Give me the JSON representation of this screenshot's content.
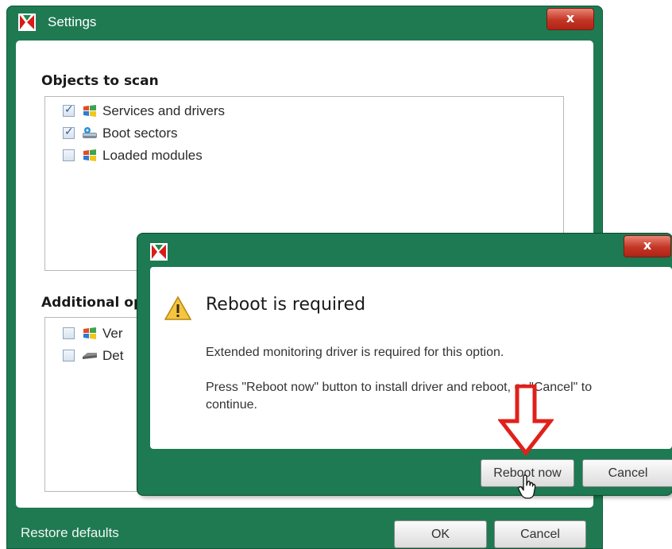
{
  "settings_window": {
    "title": "Settings",
    "close_label": "x",
    "objects_section": {
      "title": "Objects to scan",
      "items": [
        {
          "label": "Services and drivers",
          "checked": true,
          "icon": "windows-logo-icon"
        },
        {
          "label": "Boot sectors",
          "checked": true,
          "icon": "hard-drive-icon"
        },
        {
          "label": "Loaded modules",
          "checked": false,
          "icon": "windows-logo-icon"
        }
      ]
    },
    "additional_section": {
      "title": "Additional op",
      "items": [
        {
          "label": "Ver",
          "checked": false,
          "icon": "windows-logo-icon"
        },
        {
          "label": "Det",
          "checked": false,
          "icon": "drive-icon"
        }
      ]
    },
    "restore_defaults": "Restore defaults",
    "ok_label": "OK",
    "cancel_label": "Cancel"
  },
  "dialog": {
    "close_label": "x",
    "title": "Reboot is required",
    "line1": "Extended monitoring driver is required for this option.",
    "line2": "Press \"Reboot now\" button to install driver and reboot, or \"Cancel\" to continue.",
    "reboot_label": "Reboot now",
    "cancel_label": "Cancel"
  },
  "colors": {
    "window_frame": "#1f7a52",
    "close_red": "#c33625",
    "annotation_arrow": "#e0211b"
  }
}
